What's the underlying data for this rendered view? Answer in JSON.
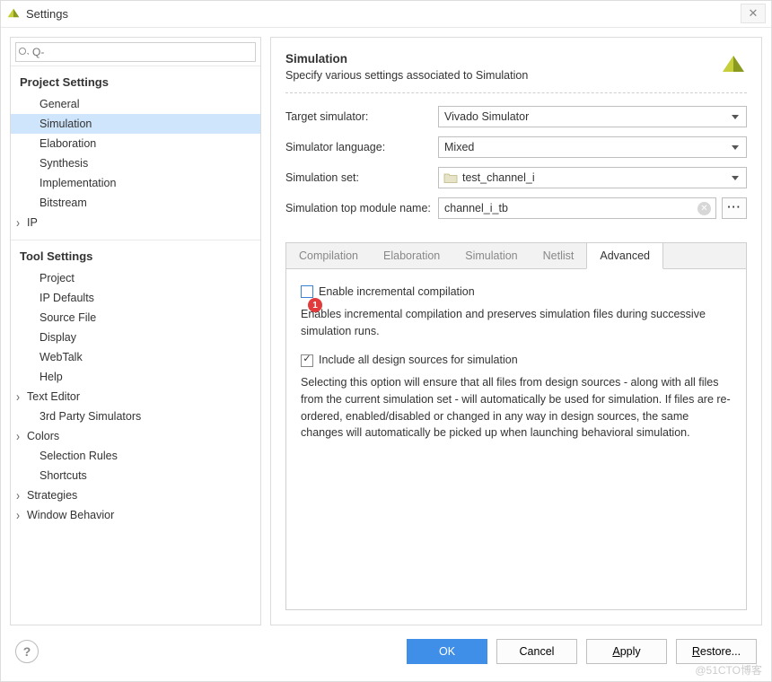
{
  "window": {
    "title": "Settings"
  },
  "search": {
    "placeholder": "Q-"
  },
  "sidebar": {
    "section1_title": "Project Settings",
    "section2_title": "Tool Settings",
    "project_items": [
      {
        "label": "General",
        "exp": false
      },
      {
        "label": "Simulation",
        "exp": false,
        "selected": true
      },
      {
        "label": "Elaboration",
        "exp": false
      },
      {
        "label": "Synthesis",
        "exp": false
      },
      {
        "label": "Implementation",
        "exp": false
      },
      {
        "label": "Bitstream",
        "exp": false
      },
      {
        "label": "IP",
        "exp": true
      }
    ],
    "tool_items": [
      {
        "label": "Project",
        "exp": false
      },
      {
        "label": "IP Defaults",
        "exp": false
      },
      {
        "label": "Source File",
        "exp": false
      },
      {
        "label": "Display",
        "exp": false
      },
      {
        "label": "WebTalk",
        "exp": false
      },
      {
        "label": "Help",
        "exp": false
      },
      {
        "label": "Text Editor",
        "exp": true
      },
      {
        "label": "3rd Party Simulators",
        "exp": false
      },
      {
        "label": "Colors",
        "exp": true
      },
      {
        "label": "Selection Rules",
        "exp": false
      },
      {
        "label": "Shortcuts",
        "exp": false
      },
      {
        "label": "Strategies",
        "exp": true
      },
      {
        "label": "Window Behavior",
        "exp": true
      }
    ]
  },
  "panel": {
    "heading": "Simulation",
    "subheading": "Specify various settings associated to Simulation",
    "fields": {
      "target_sim_label": "Target simulator:",
      "target_sim_value": "Vivado Simulator",
      "sim_lang_label": "Simulator language:",
      "sim_lang_value": "Mixed",
      "sim_set_label": "Simulation set:",
      "sim_set_value": "test_channel_i",
      "sim_top_label": "Simulation top module name:",
      "sim_top_value": "channel_i_tb"
    },
    "tabs": [
      "Compilation",
      "Elaboration",
      "Simulation",
      "Netlist",
      "Advanced"
    ],
    "active_tab": "Advanced",
    "advanced": {
      "check1_label": "Enable incremental compilation",
      "check1_checked": false,
      "check1_desc": "Enables incremental compilation and preserves simulation files during successive simulation runs.",
      "check2_label": "Include all design sources for simulation",
      "check2_checked": true,
      "check2_desc": "Selecting this option will ensure that all files from design sources - along with all files from the current simulation set - will automatically be used for simulation. If files are re-ordered, enabled/disabled or changed in any way in design sources, the same changes will automatically be picked up when launching behavioral simulation."
    },
    "annotation_1": "1"
  },
  "footer": {
    "ok": "OK",
    "cancel": "Cancel",
    "apply": "Apply",
    "restore": "Restore..."
  },
  "watermark": "@51CTO博客"
}
